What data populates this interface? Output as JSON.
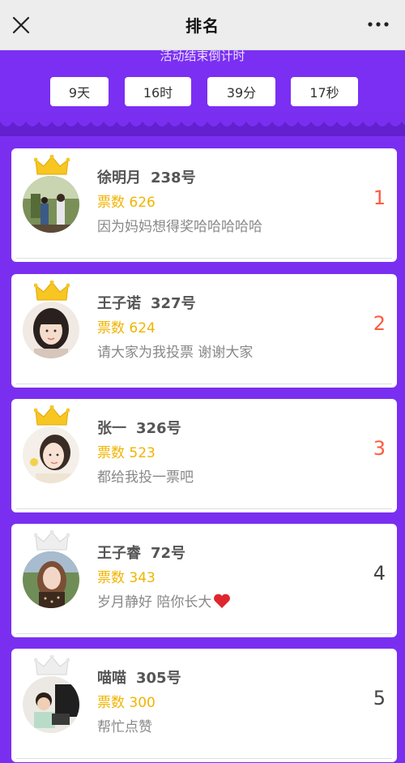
{
  "nav": {
    "title": "排名"
  },
  "countdown": {
    "label": "活动结束倒计时",
    "days": "9天",
    "hours": "16时",
    "minutes": "39分",
    "seconds": "17秒"
  },
  "entries": [
    {
      "name": "徐明月",
      "number": "238号",
      "votes": "票数 626",
      "motto": "因为妈妈想得奖哈哈哈哈哈",
      "rank": "1",
      "crown": "gold"
    },
    {
      "name": "王子诺",
      "number": "327号",
      "votes": "票数 624",
      "motto": "请大家为我投票 谢谢大家",
      "rank": "2",
      "crown": "gold"
    },
    {
      "name": "张一",
      "number": "326号",
      "votes": "票数 523",
      "motto": "都给我投一票吧",
      "rank": "3",
      "crown": "gold"
    },
    {
      "name": "王子睿",
      "number": "72号",
      "votes": "票数 343",
      "motto": "岁月静好 陪你长大",
      "rank": "4",
      "crown": "silver"
    },
    {
      "name": "喵喵",
      "number": "305号",
      "votes": "票数 300",
      "motto": "帮忙点赞",
      "rank": "5",
      "crown": "silver"
    }
  ],
  "colors": {
    "brand_purple": "#7b2ff2",
    "vote_yellow": "#f0b400",
    "top_rank_red": "#ff5a3d"
  }
}
